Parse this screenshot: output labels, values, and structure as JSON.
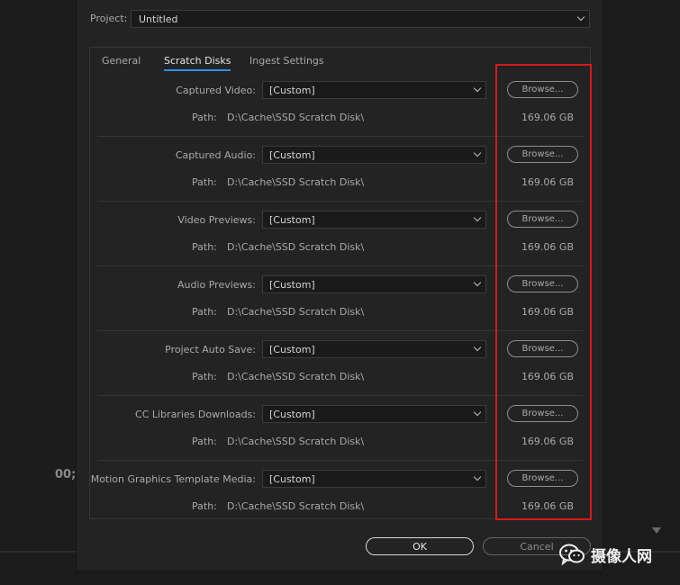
{
  "project": {
    "label": "Project:",
    "value": "Untitled"
  },
  "tabs": [
    {
      "label": "General",
      "active": false
    },
    {
      "label": "Scratch Disks",
      "active": true
    },
    {
      "label": "Ingest Settings",
      "active": false
    }
  ],
  "rows": [
    {
      "label": "Captured Video:",
      "value": "[Custom]",
      "path_label": "Path:",
      "path": "D:\\Cache\\SSD Scratch Disk\\",
      "size": "169.06 GB",
      "browse": "Browse..."
    },
    {
      "label": "Captured Audio:",
      "value": "[Custom]",
      "path_label": "Path:",
      "path": "D:\\Cache\\SSD Scratch Disk\\",
      "size": "169.06 GB",
      "browse": "Browse..."
    },
    {
      "label": "Video Previews:",
      "value": "[Custom]",
      "path_label": "Path:",
      "path": "D:\\Cache\\SSD Scratch Disk\\",
      "size": "169.06 GB",
      "browse": "Browse..."
    },
    {
      "label": "Audio Previews:",
      "value": "[Custom]",
      "path_label": "Path:",
      "path": "D:\\Cache\\SSD Scratch Disk\\",
      "size": "169.06 GB",
      "browse": "Browse..."
    },
    {
      "label": "Project Auto Save:",
      "value": "[Custom]",
      "path_label": "Path:",
      "path": "D:\\Cache\\SSD Scratch Disk\\",
      "size": "169.06 GB",
      "browse": "Browse..."
    },
    {
      "label": "CC Libraries Downloads:",
      "value": "[Custom]",
      "path_label": "Path:",
      "path": "D:\\Cache\\SSD Scratch Disk\\",
      "size": "169.06 GB",
      "browse": "Browse..."
    },
    {
      "label": "Motion Graphics Template Media:",
      "value": "[Custom]",
      "path_label": "Path:",
      "path": "D:\\Cache\\SSD Scratch Disk\\",
      "size": "169.06 GB",
      "browse": "Browse..."
    }
  ],
  "buttons": {
    "ok": "OK",
    "cancel": "Cancel"
  },
  "background": {
    "timecode": "00;"
  },
  "watermark": {
    "text": "摄像人网",
    "icon": "wechat-icon"
  },
  "colors": {
    "accent_tab": "#2d8ceb",
    "highlight": "#d51a1a"
  }
}
